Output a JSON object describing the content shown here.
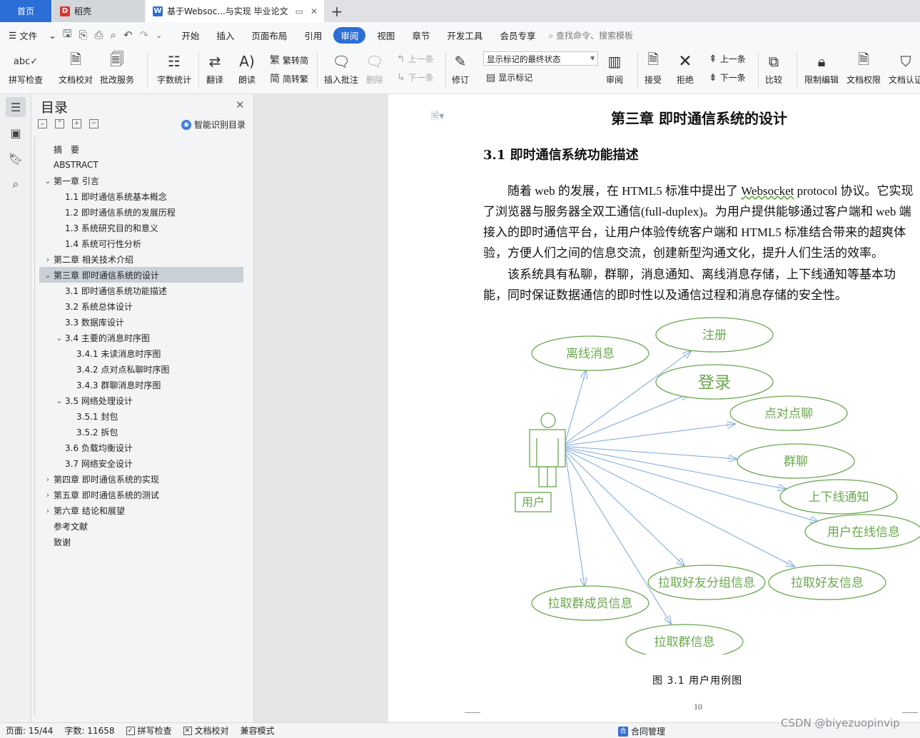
{
  "tabs": {
    "home": "首页",
    "daoke": "稻壳",
    "doc": "基于Websoc...与实现 毕业论文",
    "new_tab": "+"
  },
  "menu": {
    "file": "文件",
    "items": [
      "开始",
      "插入",
      "页面布局",
      "引用",
      "审阅",
      "视图",
      "章节",
      "开发工具",
      "会员专享"
    ],
    "active": "审阅",
    "search_placeholder": "查找命令、搜索模板"
  },
  "ribbon": {
    "spell_check": "拼写检查",
    "doc_proof": "文档校对",
    "batch_service": "批改服务",
    "word_count": "字数统计",
    "translate": "翻译",
    "read_aloud": "朗读",
    "simp_to_trad": "繁转简",
    "trad_to_simp": "简转繁",
    "insert_comment": "插入批注",
    "delete": "删除",
    "prev_comment": "上一条",
    "next_comment": "下一条",
    "revise": "修订",
    "markup_state": "显示标记的最终状态",
    "show_markup": "显示标记",
    "review": "审阅",
    "accept": "接受",
    "reject": "拒绝",
    "prev_change": "上一条",
    "next_change": "下一条",
    "compare": "比较",
    "restrict_edit": "限制编辑",
    "doc_permission": "文档权限",
    "doc_cert": "文档认证"
  },
  "toc": {
    "title": "目录",
    "smart_toc": "智能识别目录",
    "items": [
      {
        "label": "摘　要",
        "level": 0,
        "arrow": ""
      },
      {
        "label": "ABSTRACT",
        "level": 0,
        "arrow": ""
      },
      {
        "label": "第一章  引言",
        "level": 0,
        "arrow": "v"
      },
      {
        "label": "1.1  即时通信系统基本概念",
        "level": 1,
        "arrow": ""
      },
      {
        "label": "1.2  即时通信系统的发展历程",
        "level": 1,
        "arrow": ""
      },
      {
        "label": "1.3  系统研究目的和意义",
        "level": 1,
        "arrow": ""
      },
      {
        "label": "1.4  系统可行性分析",
        "level": 1,
        "arrow": ""
      },
      {
        "label": "第二章  相关技术介绍",
        "level": 0,
        "arrow": ">"
      },
      {
        "label": "第三章  即时通信系统的设计",
        "level": 0,
        "arrow": "v",
        "selected": true
      },
      {
        "label": "3.1  即时通信系统功能描述",
        "level": 1,
        "arrow": ""
      },
      {
        "label": "3.2 系统总体设计",
        "level": 1,
        "arrow": ""
      },
      {
        "label": "3.3 数据库设计",
        "level": 1,
        "arrow": ""
      },
      {
        "label": "3.4 主要的消息时序图",
        "level": 1,
        "arrow": "v"
      },
      {
        "label": "3.4.1  未读消息时序图",
        "level": 2,
        "arrow": ""
      },
      {
        "label": "3.4.2 点对点私聊时序图",
        "level": 2,
        "arrow": ""
      },
      {
        "label": "3.4.3 群聊消息时序图",
        "level": 2,
        "arrow": ""
      },
      {
        "label": "3.5 网络处理设计",
        "level": 1,
        "arrow": "v"
      },
      {
        "label": "3.5.1 封包",
        "level": 2,
        "arrow": ""
      },
      {
        "label": "3.5.2 拆包",
        "level": 2,
        "arrow": ""
      },
      {
        "label": "3.6 负载均衡设计",
        "level": 1,
        "arrow": ""
      },
      {
        "label": "3.7 网络安全设计",
        "level": 1,
        "arrow": ""
      },
      {
        "label": "第四章  即时通信系统的实现",
        "level": 0,
        "arrow": ">"
      },
      {
        "label": "第五章  即时通信系统的测试",
        "level": 0,
        "arrow": ">"
      },
      {
        "label": "第六章  结论和展望",
        "level": 0,
        "arrow": ">"
      },
      {
        "label": "参考文献",
        "level": 0,
        "arrow": ""
      },
      {
        "label": "致谢",
        "level": 0,
        "arrow": ""
      }
    ]
  },
  "page": {
    "chapter_title": "第三章  即时通信系统的设计",
    "section_title": "3.1  即时通信系统功能描述",
    "para1_a": "随着 web 的发展，在 HTML5 标准中提出了 ",
    "para1_link": "Websocket",
    "para1_b": " protocol 协议。它实现了浏览器与服务器全双工通信(full-duplex)。为用户提供能够通过客户端和 web 端接入的即时通信平台，让用户体验传统客户端和 HTML5 标准结合带来的超爽体验，方便人们之间的信息交流，创建新型沟通文化，提升人们生活的效率。",
    "para2": "该系统具有私聊，群聊，消息通知、离线消息存储，上下线通知等基本功能，同时保证数据通信的即时性以及通信过程和消息存储的安全性。",
    "diagram": {
      "actor": "用户",
      "use_cases": [
        "离线消息",
        "注册",
        "登录",
        "点对点聊",
        "群聊",
        "上下线通知",
        "用户在线信息",
        "拉取好友信息",
        "拉取好友分组信息",
        "拉取群成员信息",
        "拉取群信息"
      ]
    },
    "figure_caption": "图 3.1    用户用例图",
    "page_number": "10"
  },
  "status": {
    "page": "页面: 15/44",
    "words": "字数: 11658",
    "spell": "拼写检查",
    "proof": "文档校对",
    "compat": "兼容模式",
    "contract": "合同管理"
  },
  "watermark": "CSDN @biyezuopinvip",
  "colors": {
    "accent": "#2b6fd6",
    "diagram_green": "#6aa84f",
    "arrow_blue": "#7aa6d9",
    "toc_selected": "#c9d0d8"
  }
}
